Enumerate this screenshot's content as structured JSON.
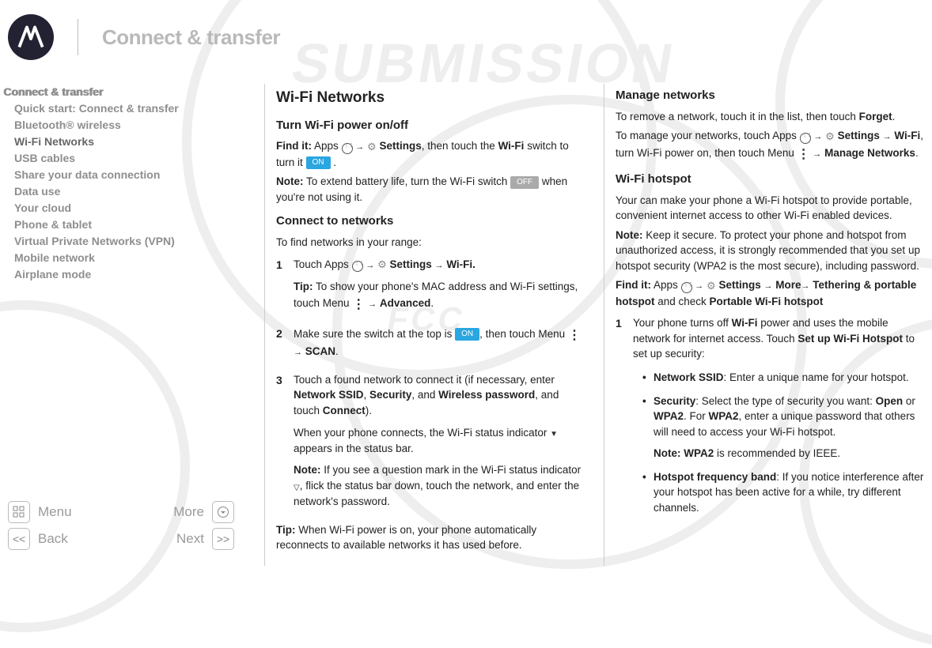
{
  "header": {
    "title": "Connect & transfer"
  },
  "sidebar": {
    "top": "Connect & transfer",
    "items": [
      "Quick start: Connect & transfer",
      "Bluetooth® wireless",
      "Wi-Fi Networks",
      "USB cables",
      "Share your data connection",
      "Data use",
      "Your cloud",
      "Phone & tablet",
      "Virtual Private Networks (VPN)",
      "Mobile network",
      "Airplane mode"
    ],
    "active_index": 2
  },
  "nav": {
    "menu": "Menu",
    "more": "More",
    "back": "Back",
    "next": "Next"
  },
  "col1": {
    "h2": "Wi-Fi Networks",
    "sec1_h": "Turn Wi-Fi power on/off",
    "sec1_p1a": "Find it:",
    "sec1_p1b": " Apps ",
    "sec1_p1c": "Settings",
    "sec1_p1d": ", then touch the ",
    "sec1_p1e": "Wi-Fi",
    "sec1_p1f": " switch to turn it ",
    "on": "ON",
    "off": "OFF",
    "sec1_p2a": "Note:",
    "sec1_p2b": " To extend battery life, turn the Wi-Fi switch ",
    "sec1_p2c": " when you're not using it.",
    "sec2_h": "Connect to networks",
    "sec2_intro": "To find networks in your range:",
    "li1a": "Touch Apps ",
    "li1b": "Settings",
    "li1c": "Wi-Fi.",
    "li1_tip_a": "Tip:",
    "li1_tip_b": " To show your phone's MAC address and Wi-Fi settings, touch Menu ",
    "li1_tip_c": "Advanced",
    "li1_tip_d": ".",
    "li2a": "Make sure the switch at the top is ",
    "li2b": ", then touch Menu ",
    "li2c": "SCAN",
    "li2d": ".",
    "li3a": "Touch a found network to connect it (if necessary, enter ",
    "li3b": "Network SSID",
    "li3c": ", ",
    "li3d": "Security",
    "li3e": ", and ",
    "li3f": "Wireless password",
    "li3g": ", and touch ",
    "li3h": "Connect",
    "li3i": ").",
    "li3_p2a": "When your phone connects, the Wi-Fi status indicator ",
    "li3_p2b": " appears in the status bar.",
    "li3_note_a": "Note:",
    "li3_note_b": " If you see a question mark in the Wi-Fi status indicator ",
    "li3_note_c": ", flick the status bar down, touch the network, and enter the network's password.",
    "tip2_a": "Tip:",
    "tip2_b": " When Wi-Fi power is on, your phone automatically reconnects to available networks it has used before."
  },
  "col2": {
    "h3a": "Manage networks",
    "p1a": "To remove a network, touch it in the list, then touch ",
    "p1b": "Forget",
    "p1c": ".",
    "p2a": "To manage your networks, touch Apps ",
    "p2b": "Settings",
    "p2c": "Wi-Fi",
    "p2d": ", turn Wi-Fi power on, then touch Menu ",
    "p2e": "Manage Networks",
    "p2f": ".",
    "h3b": "Wi-Fi hotspot",
    "p3": "Your can make your phone a Wi-Fi hotspot to provide portable, convenient internet access to other Wi-Fi enabled devices.",
    "p4a": "Note:",
    "p4b": " Keep it secure. To protect your phone and hotspot from unauthorized access, it is strongly recommended that you set up hotspot security (WPA2 is the most secure), including password.",
    "p5a": "Find it:",
    "p5b": " Apps ",
    "p5c": "Settings",
    "p5d": "More",
    "p5e": "Tethering & portable hotspot",
    "p5f": " and check ",
    "p5g": "Portable Wi-Fi hotspot",
    "li1a": "Your phone turns off ",
    "li1b": "Wi-Fi",
    "li1c": " power and uses the mobile network for internet access. Touch ",
    "li1d": "Set up Wi-Fi Hotspot",
    "li1e": " to set up security:",
    "b1a": "Network SSID",
    "b1b": ": Enter a unique name for your hotspot.",
    "b2a": "Security",
    "b2b": ": Select the type of security you want: ",
    "b2c": "Open",
    "b2d": " or ",
    "b2e": "WPA2",
    "b2f": ". For ",
    "b2g": "WPA2",
    "b2h": ", enter a unique password that others will need to access your Wi-Fi hotspot.",
    "b2note_a": "Note: ",
    "b2note_b": "WPA2",
    "b2note_c": " is recommended by IEEE.",
    "b3a": "Hotspot frequency band",
    "b3b": ": If you notice interference after your hotspot has been active for a while, try different channels."
  }
}
